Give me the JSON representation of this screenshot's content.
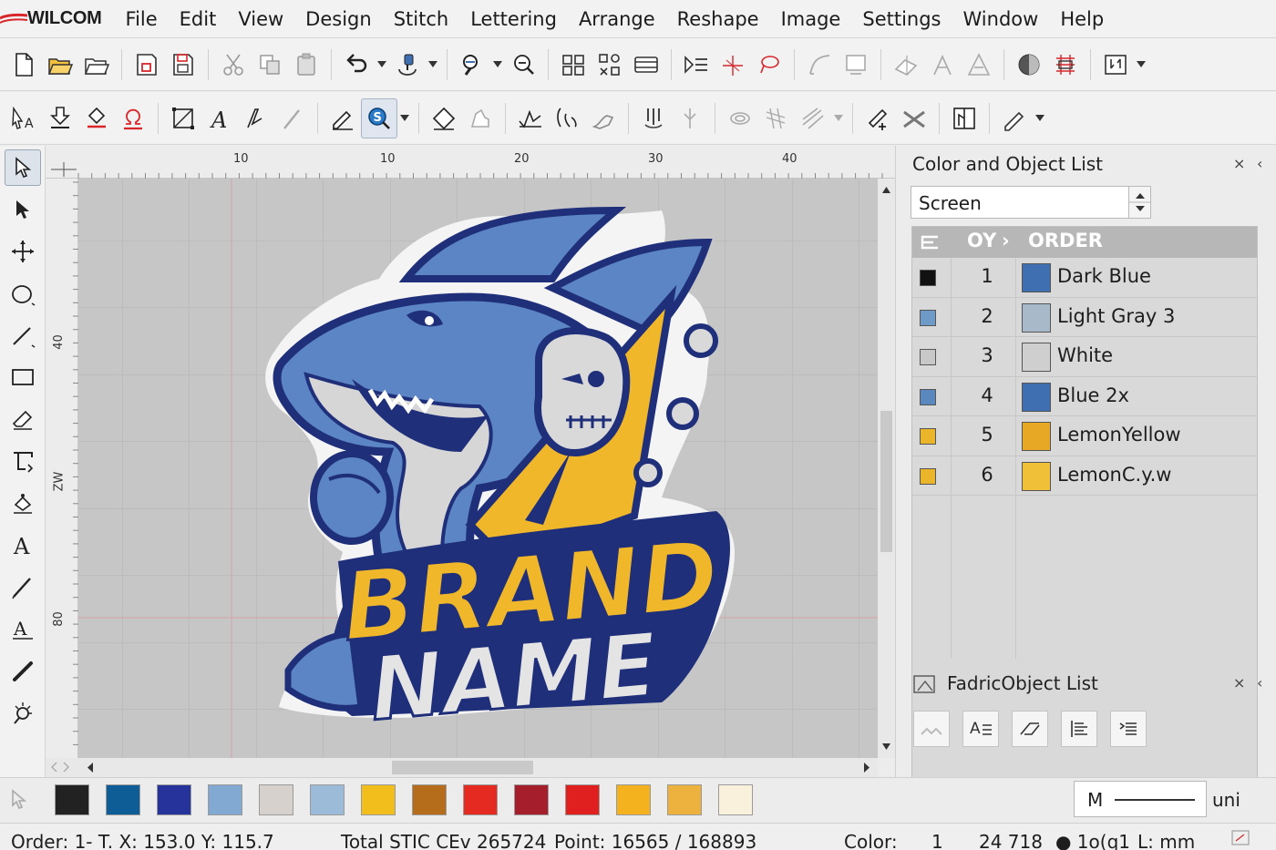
{
  "app": {
    "name": "WILCOM"
  },
  "menu": [
    "File",
    "Edit",
    "View",
    "Design",
    "Stitch",
    "Lettering",
    "Arrange",
    "Reshape",
    "Image",
    "Settings",
    "Window",
    "Help"
  ],
  "ruler": {
    "top_labels": [
      "10",
      "10",
      "20",
      "30",
      "40"
    ],
    "left_labels": [
      "40",
      "ZW",
      "80"
    ]
  },
  "design": {
    "line1": "BRAND",
    "line2": "NAME"
  },
  "color_panel": {
    "title": "Color and Object List",
    "view_select": "Screen",
    "headers": {
      "qty": "OY",
      "order": "ORDER"
    },
    "rows": [
      {
        "num": "1",
        "name": "Dark Blue",
        "small": "#111111",
        "big": "#3f6fb0"
      },
      {
        "num": "2",
        "name": "Light Gray 3",
        "small": "#6e9ac8",
        "big": "#a8bac9"
      },
      {
        "num": "3",
        "name": "White",
        "small": "#c8c8c8",
        "big": "#cfcfcf"
      },
      {
        "num": "4",
        "name": "Blue 2x",
        "small": "#5a87bd",
        "big": "#3f6fb0"
      },
      {
        "num": "5",
        "name": "LemonYellow",
        "small": "#eab52a",
        "big": "#e7a825"
      },
      {
        "num": "6",
        "name": "LemonC.y.w",
        "small": "#eab52a",
        "big": "#f0c039"
      }
    ]
  },
  "fabric_panel": {
    "title": "FadricObject List"
  },
  "palette": {
    "colors": [
      "#222222",
      "#0e5d97",
      "#25339a",
      "#82a9d2",
      "#d6d1cd",
      "#9bbbd8",
      "#f1be1c",
      "#b56c1b",
      "#e52a21",
      "#a51e2c",
      "#e01f1f",
      "#f5b21f",
      "#edb23e",
      "#faf1dc"
    ],
    "m_field": "M",
    "unit": "uni"
  },
  "status": {
    "order": "Order: 1- T. X: 153.0  Y: 115.7",
    "total": "Total STIC CEv 265724",
    "point": "Point:  16565 / 168893",
    "color": "Color:",
    "color_num": "1",
    "count": "24 718",
    "lo": "● 1o(q1",
    "units": "L: mm"
  }
}
